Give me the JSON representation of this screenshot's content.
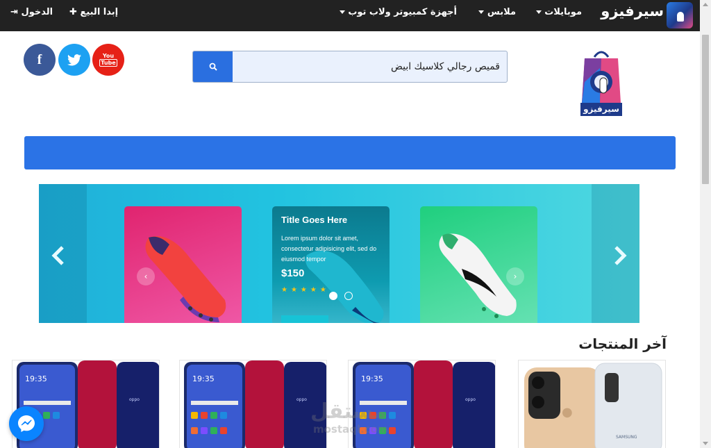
{
  "topnav": {
    "brand": "سيرفيزو",
    "menu": [
      {
        "label": "موبايلات"
      },
      {
        "label": "ملابس"
      },
      {
        "label": "أجهزة كمبيوتر ولاب توب"
      }
    ],
    "sell_label": "إبدا البيع",
    "login_label": "الدخول"
  },
  "header": {
    "search_value": "قميص رجالي كلاسيك ابيض",
    "logo_text": "سيرفيزو",
    "social": {
      "facebook": "f",
      "youtube_top": "You",
      "youtube_bottom": "Tube"
    }
  },
  "carousel": {
    "card_title": "Title Goes Here",
    "card_desc": "Lorem ipsum dolor sit amet, consectetur adipisicing elit, sed do eiusmod tempor",
    "card_price": "$150",
    "stars": "★★★★★",
    "prev": "‹",
    "next": "›"
  },
  "products_section": {
    "title": "آخر المنتجات",
    "phone_time": "19:35",
    "oppo_brand": "oppo",
    "samsung_brand": "SAMSUNG"
  },
  "watermark": {
    "ar": "مستقل",
    "en": "mostaql.com"
  },
  "colors": {
    "nav_bg": "#222222",
    "accent_blue": "#2b73e6",
    "facebook": "#3b5998",
    "twitter": "#1da1f2",
    "youtube": "#e62117",
    "messenger": "#0a84ff"
  }
}
